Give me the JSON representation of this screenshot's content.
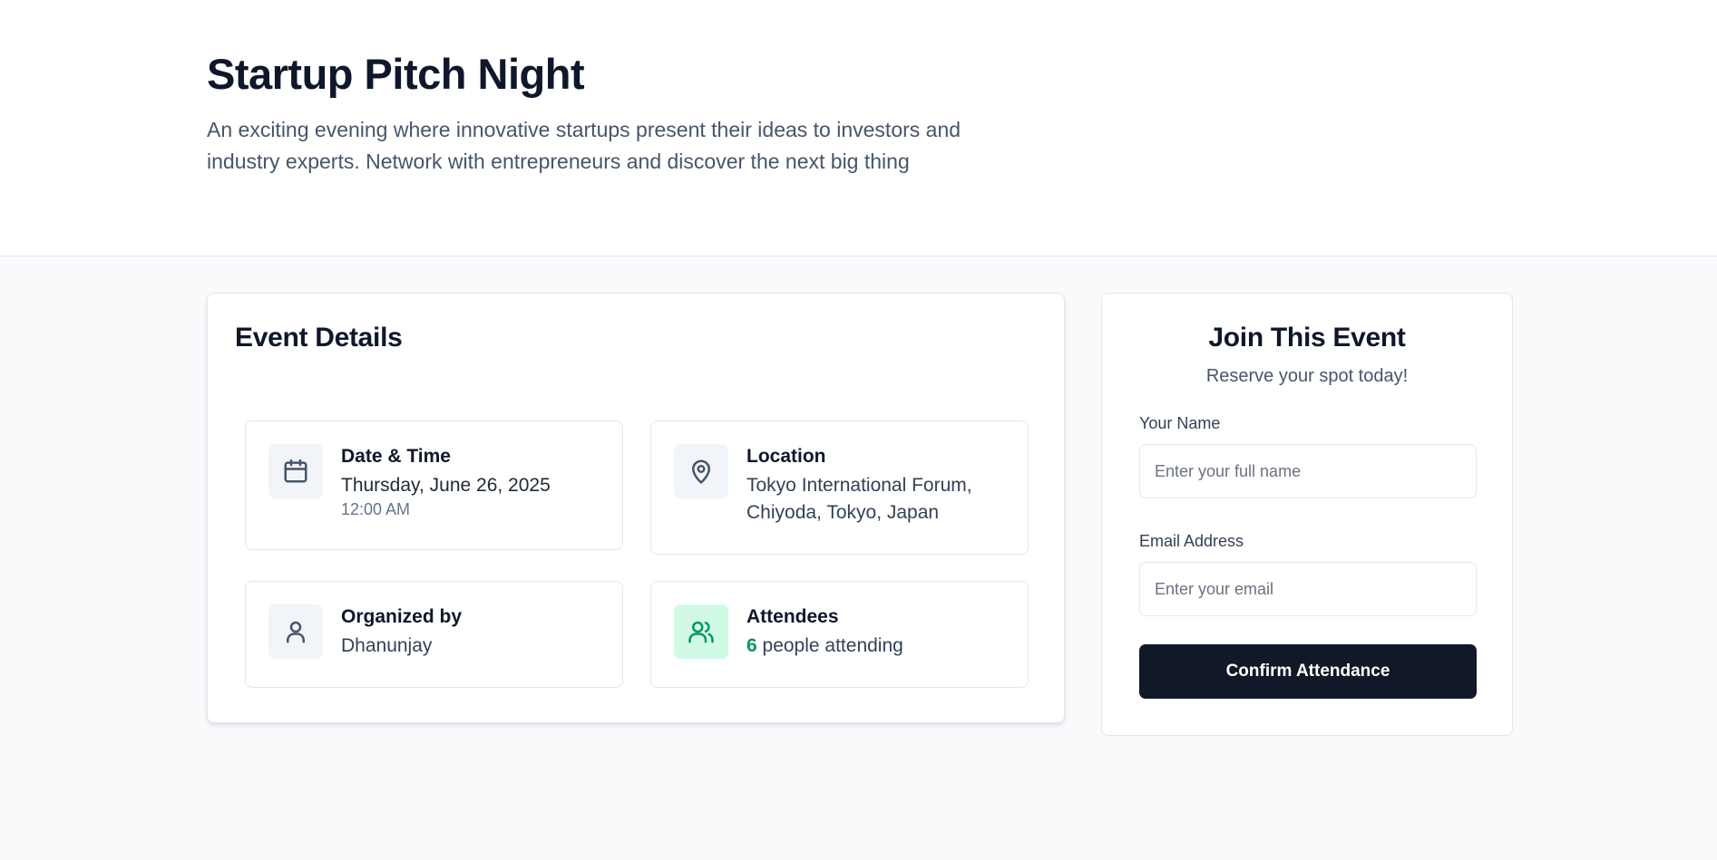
{
  "event": {
    "title": "Startup Pitch Night",
    "description": "An exciting evening where innovative startups present their ideas to investors and industry experts. Network with entrepreneurs and discover the next big thing"
  },
  "details": {
    "heading": "Event Details",
    "date_time": {
      "label": "Date & Time",
      "date": "Thursday, June 26, 2025",
      "time": "12:00 AM",
      "icon": "calendar-icon"
    },
    "location": {
      "label": "Location",
      "value": "Tokyo International Forum, Chiyoda, Tokyo, Japan",
      "icon": "map-pin-icon"
    },
    "organizer": {
      "label": "Organized by",
      "value": "Dhanunjay",
      "icon": "user-icon"
    },
    "attendees": {
      "label": "Attendees",
      "count": "6",
      "suffix": " people attending",
      "icon": "users-icon"
    }
  },
  "join": {
    "heading": "Join This Event",
    "tagline": "Reserve your spot today!",
    "name_label": "Your Name",
    "name_placeholder": "Enter your full name",
    "name_value": "",
    "email_label": "Email Address",
    "email_placeholder": "Enter your email",
    "email_value": "",
    "button_label": "Confirm Attendance"
  },
  "colors": {
    "primary_button": "#111827",
    "accent_green": "#059669",
    "page_bg": "#f8fafc",
    "text_dark": "#0f172a"
  }
}
